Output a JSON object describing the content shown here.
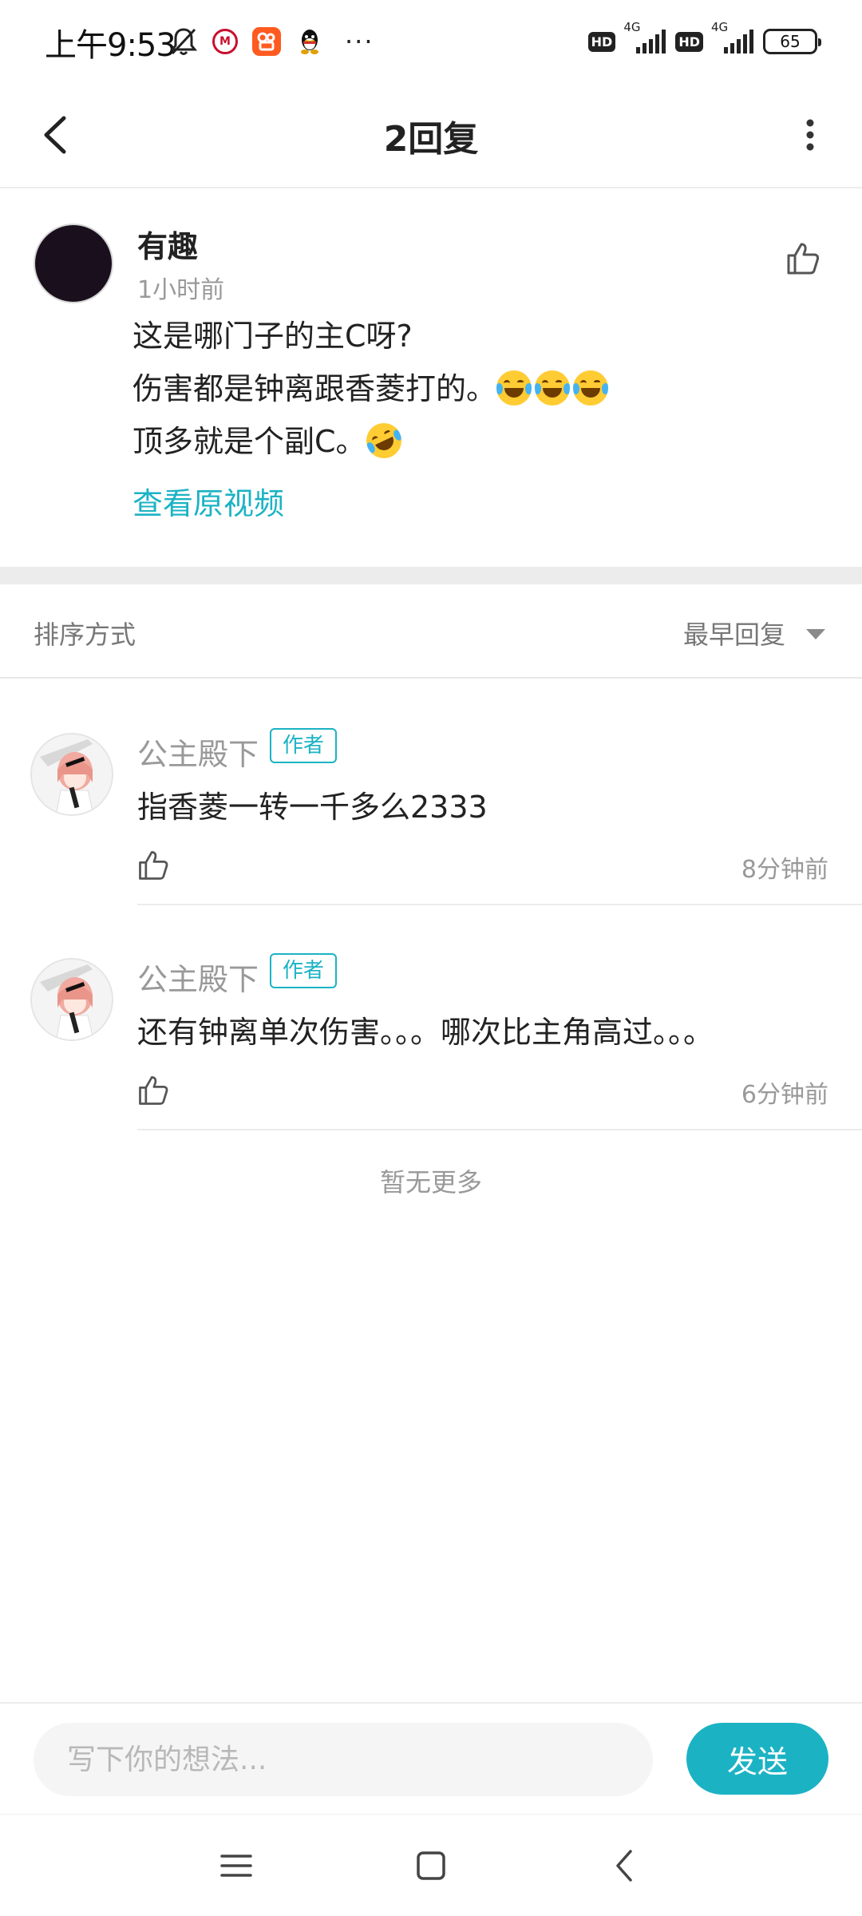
{
  "status_bar": {
    "time": "上午9:53",
    "hd_label_1": "HD",
    "hd_label_2": "HD",
    "network_1": "4G",
    "network_2": "4G",
    "battery": "65",
    "more": "···"
  },
  "header": {
    "title": "2回复",
    "back_icon": "chevron-left-icon",
    "more_icon": "more-vertical-icon"
  },
  "main_comment": {
    "username": "有趣",
    "time": "1小时前",
    "lines": [
      "这是哪门子的主C呀?",
      "伤害都是钟离跟香菱打的。",
      "顶多就是个副C。"
    ],
    "view_original": "查看原视频"
  },
  "sort": {
    "label": "排序方式",
    "value": "最早回复"
  },
  "replies": [
    {
      "username": "公主殿下",
      "badge": "作者",
      "text": "指香菱一转一千多么2333",
      "time": "8分钟前"
    },
    {
      "username": "公主殿下",
      "badge": "作者",
      "text": "还有钟离单次伤害。。。哪次比主角高过。。。",
      "time": "6分钟前"
    }
  ],
  "no_more": "暂无更多",
  "input": {
    "placeholder": "写下你的想法...",
    "send_label": "发送"
  },
  "colors": {
    "accent": "#1bb3c4",
    "muted_text": "#999999",
    "divider": "#ececec"
  }
}
